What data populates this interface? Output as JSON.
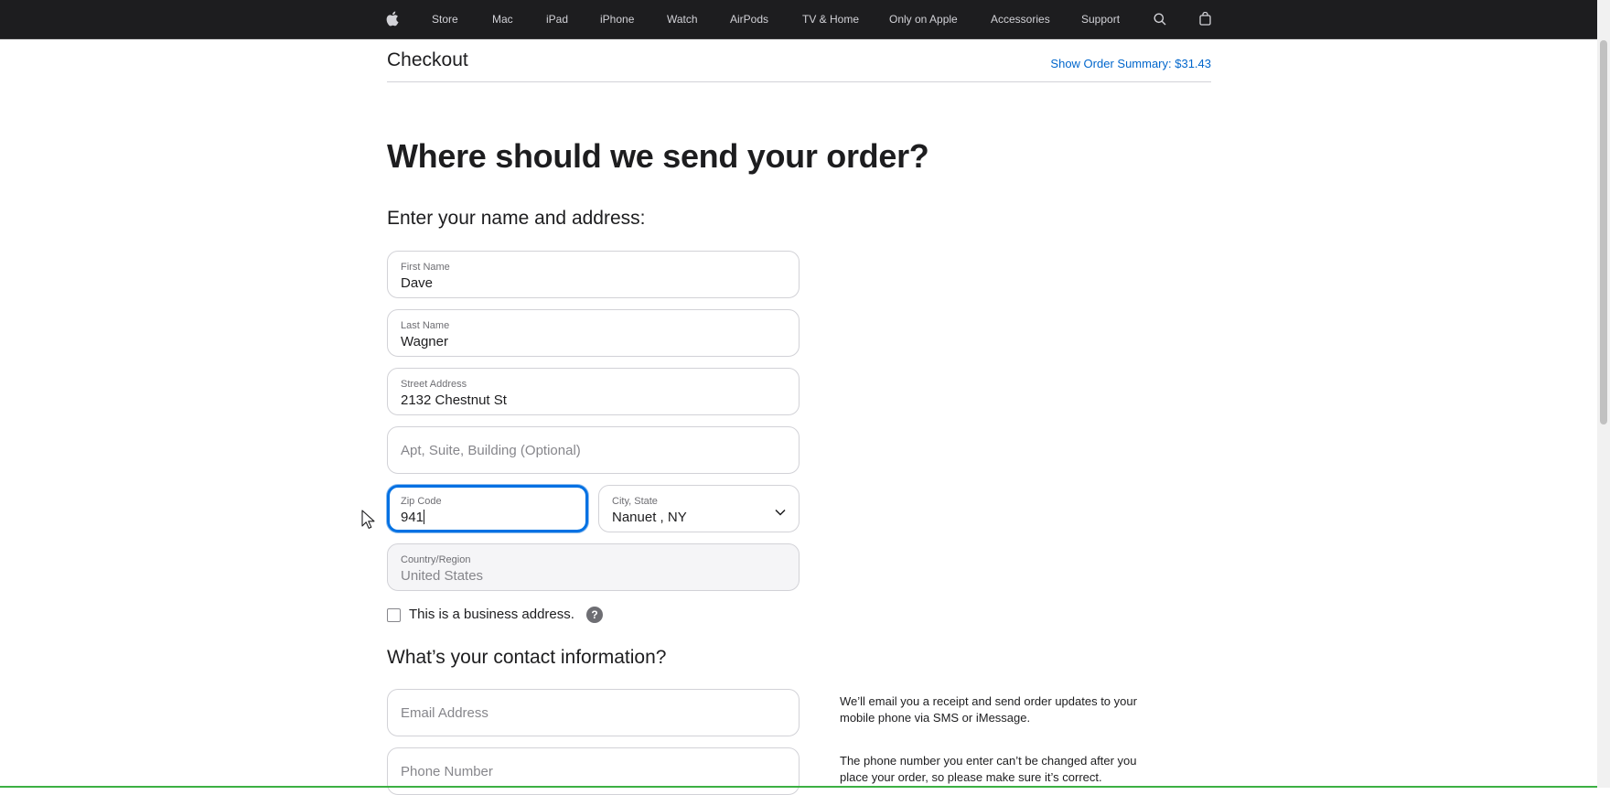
{
  "nav": {
    "items": [
      "Store",
      "Mac",
      "iPad",
      "iPhone",
      "Watch",
      "AirPods",
      "TV & Home",
      "Only on Apple",
      "Accessories",
      "Support"
    ],
    "icons": {
      "logo": "apple-logo-icon",
      "search": "search-icon",
      "bag": "shopping-bag-icon"
    }
  },
  "checkout": {
    "title": "Checkout",
    "order_summary": "Show Order Summary: $31.43"
  },
  "headings": {
    "main": "Where should we send your order?",
    "address": "Enter your name and address:",
    "contact": "What’s your contact information?"
  },
  "form": {
    "first_name": {
      "label": "First Name",
      "value": "Dave"
    },
    "last_name": {
      "label": "Last Name",
      "value": "Wagner"
    },
    "street": {
      "label": "Street Address",
      "value": "2132 Chestnut St"
    },
    "apt": {
      "placeholder": "Apt, Suite, Building (Optional)"
    },
    "zip": {
      "label": "Zip Code",
      "value": "941"
    },
    "city_state": {
      "label": "City, State",
      "value": "Nanuet , NY"
    },
    "country": {
      "label": "Country/Region",
      "value": "United States"
    },
    "business": {
      "label": "This is a business address.",
      "help": "?"
    },
    "email": {
      "placeholder": "Email Address"
    },
    "phone": {
      "placeholder": "Phone Number"
    }
  },
  "notes": {
    "email": "We’ll email you a receipt and send order updates to your mobile phone via SMS or iMessage.",
    "phone": "The phone number you enter can’t be changed after you place your order, so please make sure it’s correct."
  },
  "colors": {
    "nav_bg": "#1d1d1f",
    "link": "#0066cc",
    "focus": "#0071e3"
  }
}
